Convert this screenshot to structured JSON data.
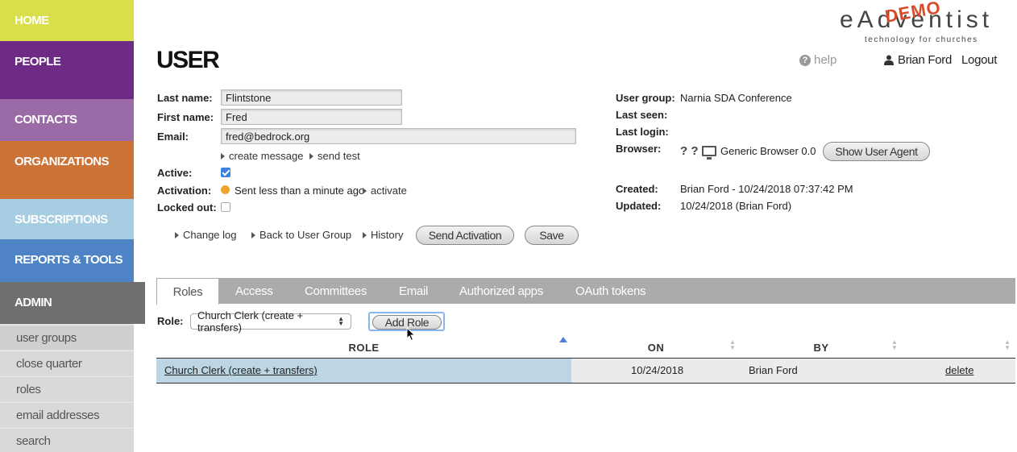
{
  "sidebar": {
    "nav": [
      "HOME",
      "PEOPLE",
      "CONTACTS",
      "ORGANIZATIONS",
      "SUBSCRIPTIONS",
      "REPORTS & TOOLS",
      "ADMIN"
    ],
    "admin_items": [
      "user groups",
      "close quarter",
      "roles",
      "email addresses",
      "search"
    ]
  },
  "header": {
    "title": "USER",
    "logo_main": "eAdventist",
    "logo_overlay": "DEMO",
    "logo_tagline": "technology for churches",
    "help": "help",
    "user": "Brian Ford",
    "logout": "Logout"
  },
  "form": {
    "last_name_label": "Last name:",
    "last_name": "Flintstone",
    "first_name_label": "First name:",
    "first_name": "Fred",
    "email_label": "Email:",
    "email": "fred@bedrock.org",
    "create_message": "create message",
    "send_test": "send test",
    "active_label": "Active:",
    "active": true,
    "activation_label": "Activation:",
    "activation_status": "Sent less than a minute ago",
    "activate_link": "activate",
    "locked_label": "Locked out:",
    "locked": false,
    "change_log": "Change log",
    "back_link": "Back to User Group",
    "history": "History",
    "send_activation": "Send Activation",
    "save": "Save"
  },
  "info": {
    "user_group_label": "User group:",
    "user_group": "Narnia SDA Conference",
    "last_seen_label": "Last seen:",
    "last_login_label": "Last login:",
    "browser_label": "Browser:",
    "browser_unknown": "? ?",
    "browser": "Generic Browser 0.0",
    "show_agent": "Show User Agent",
    "created_label": "Created:",
    "created": "Brian Ford - 10/24/2018 07:37:42 PM",
    "updated_label": "Updated:",
    "updated": "10/24/2018 (Brian Ford)"
  },
  "tabs": [
    "Roles",
    "Access",
    "Committees",
    "Email",
    "Authorized apps",
    "OAuth tokens"
  ],
  "roles": {
    "role_label": "Role:",
    "selected_role": "Church Clerk (create + transfers)",
    "add_role": "Add Role",
    "columns": [
      "ROLE",
      "ON",
      "BY"
    ],
    "rows": [
      {
        "role": "Church Clerk (create + transfers)",
        "on": "10/24/2018",
        "by": "Brian Ford",
        "action": "delete"
      }
    ]
  },
  "colors": {
    "home": "#d9df4a",
    "people": "#6e2b86",
    "contacts": "#9a6ba7",
    "organizations": "#cc7438",
    "subscriptions": "#a6cde2",
    "reports": "#4e83c6",
    "admin": "#6f6f6f",
    "tabbar": "#ababab",
    "selected_row": "#bcd6e4",
    "activation_dot": "#f0a330"
  }
}
